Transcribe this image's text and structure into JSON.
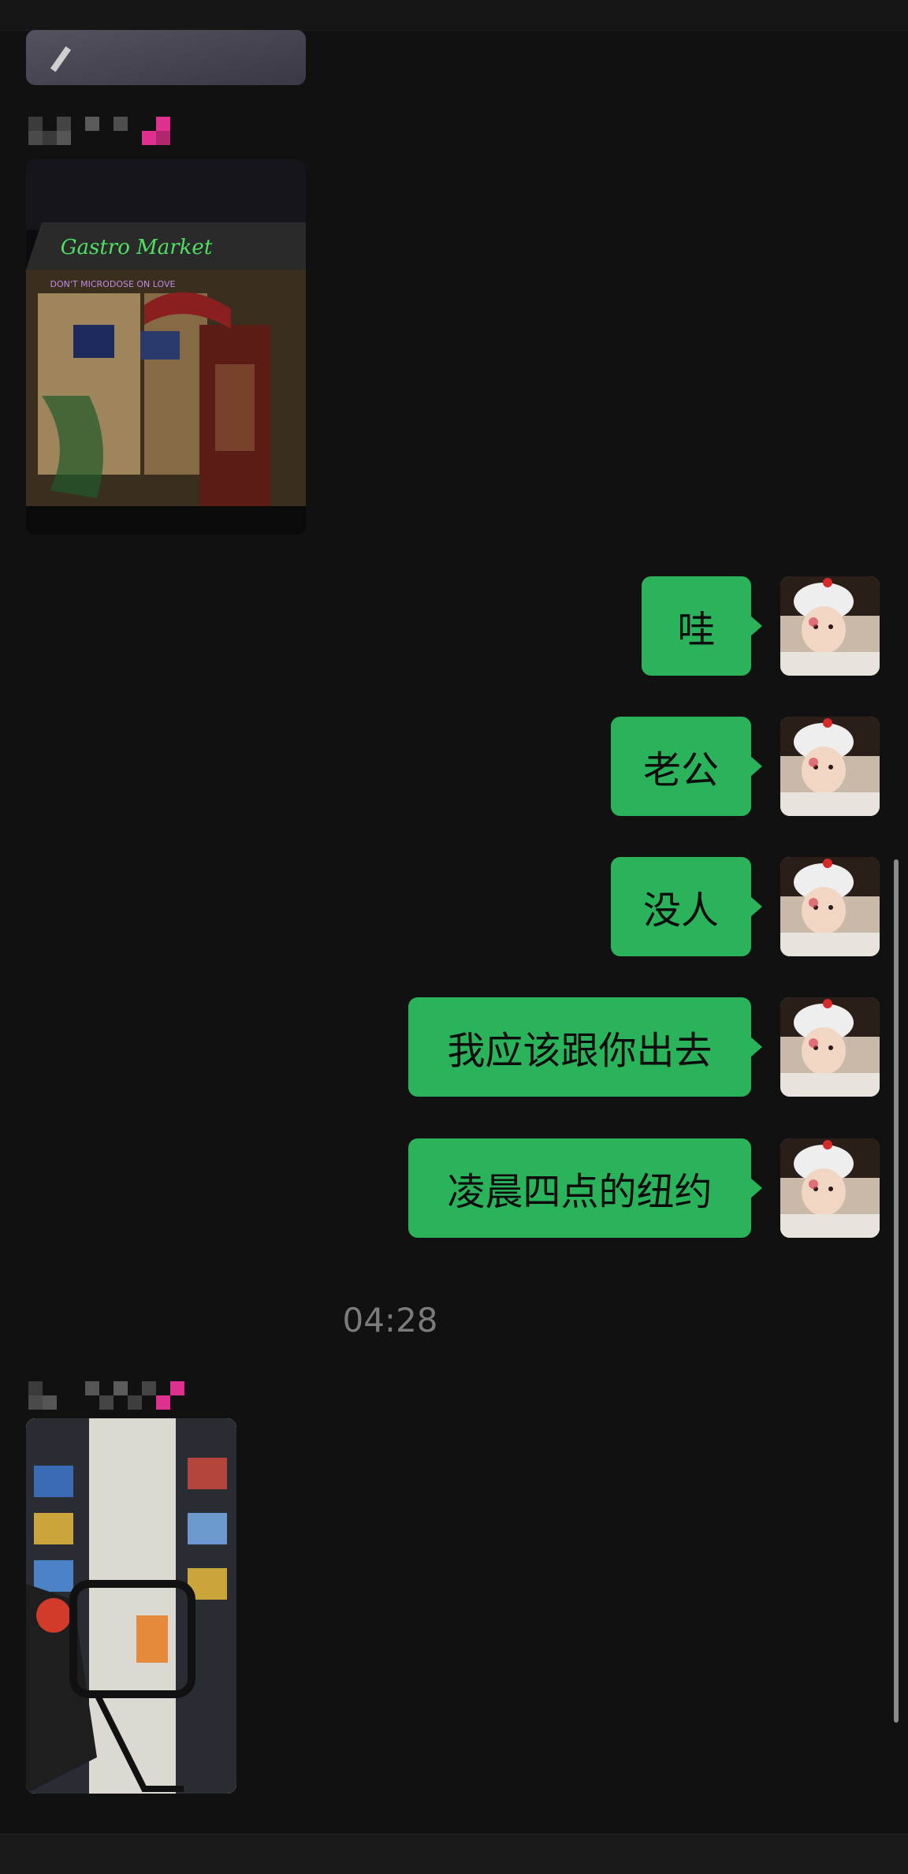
{
  "chat": {
    "messages": [
      {
        "side": "right",
        "text": "哇"
      },
      {
        "side": "right",
        "text": "老公"
      },
      {
        "side": "right",
        "text": "没人"
      },
      {
        "side": "right",
        "text": "我应该跟你出去"
      },
      {
        "side": "right",
        "text": "凌晨四点的纽约"
      }
    ],
    "timestamp": "04:28",
    "photo_sign_text": "Gastro Market",
    "photo_sign_subtext": "DON'T MICRODOSE ON LOVE"
  },
  "colors": {
    "background": "#111111",
    "bubble_green": "#2bb35b",
    "timestamp_gray": "#7b7b7b",
    "sender_pink": "#e0308f"
  }
}
